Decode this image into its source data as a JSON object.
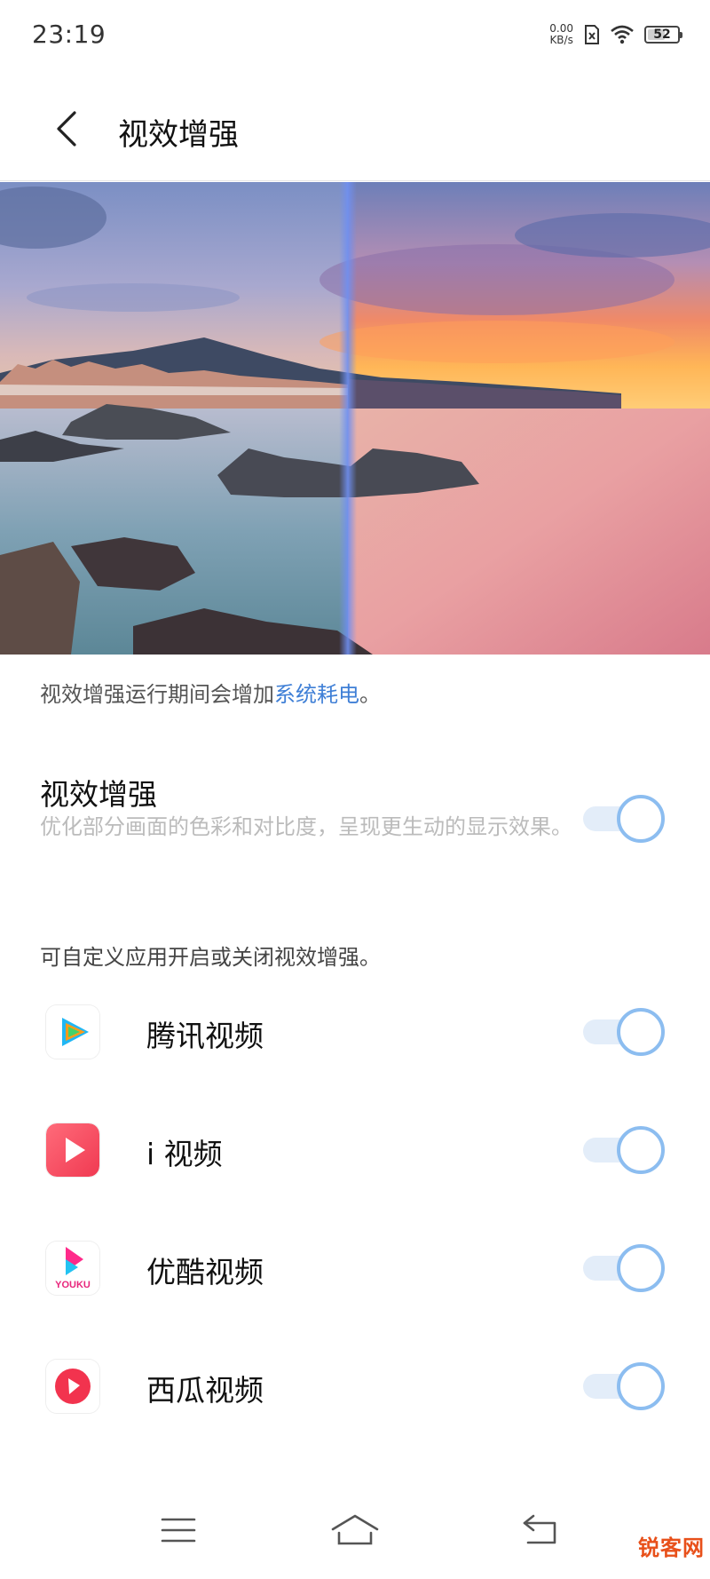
{
  "status_bar": {
    "time": "23:19",
    "net_speed_value": "0.00",
    "net_speed_unit": "KB/s",
    "battery_level": "52"
  },
  "header": {
    "title": "视效增强",
    "back_icon": "chevron-left-icon"
  },
  "notes": {
    "power_prefix": "视效增强运行期间会增加",
    "power_link": "系统耗电",
    "power_suffix": "。",
    "custom_apps": "可自定义应用开启或关闭视效增强。"
  },
  "master_setting": {
    "title": "视效增强",
    "description": "优化部分画面的色彩和对比度，呈现更生动的显示效果。",
    "enabled": true
  },
  "apps": [
    {
      "name": "腾讯视频",
      "icon": "tencent-video-icon",
      "enabled": true
    },
    {
      "name": "i 视频",
      "icon": "i-video-icon",
      "enabled": true
    },
    {
      "name": "优酷视频",
      "icon": "youku-icon",
      "enabled": true,
      "icon_text": "YOUKU"
    },
    {
      "name": "西瓜视频",
      "icon": "xigua-video-icon",
      "enabled": true
    }
  ],
  "nav_bar": {
    "menu_icon": "menu-icon",
    "home_icon": "home-icon",
    "back_icon": "back-arrow-icon"
  },
  "watermark": {
    "text": "锐客网"
  },
  "colors": {
    "accent": "#3f7fd6",
    "toggle_track": "#e3edf9",
    "toggle_ring": "#8cbdf0"
  }
}
